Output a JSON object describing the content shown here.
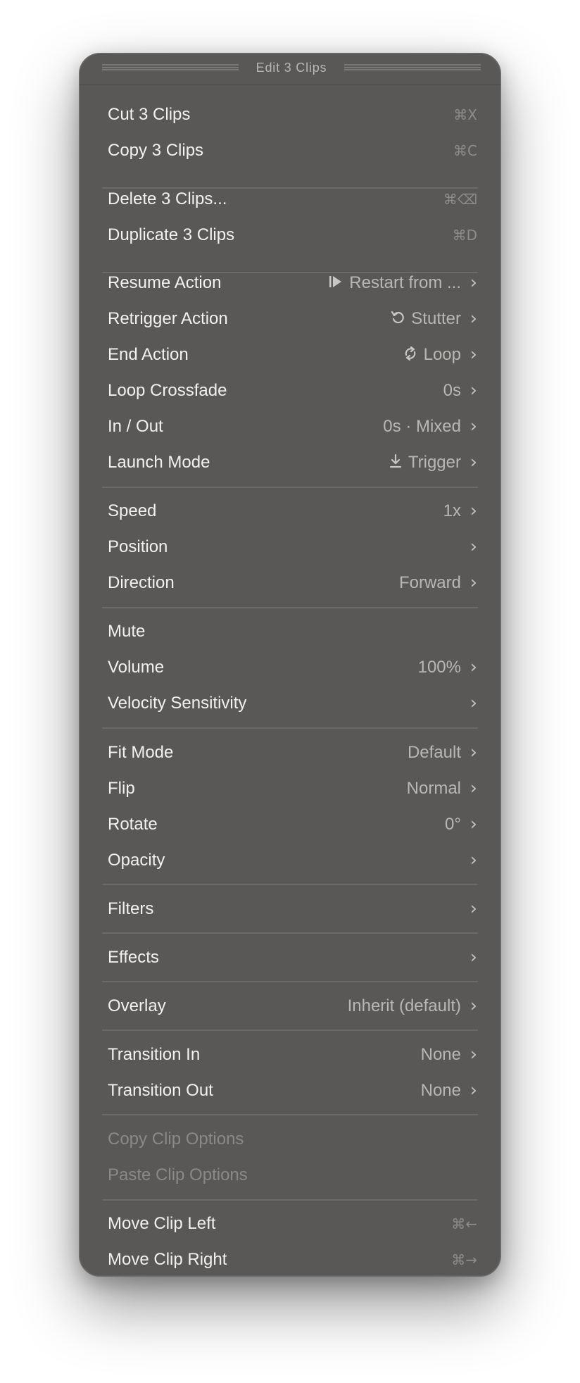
{
  "menu": {
    "title": "Edit 3 Clips",
    "items": [
      {
        "label": "Cut 3 Clips",
        "shortcut": "⌘X"
      },
      {
        "label": "Copy 3 Clips",
        "shortcut": "⌘C"
      },
      {
        "label": "Delete 3 Clips...",
        "shortcut": "⌘⌫"
      },
      {
        "label": "Duplicate 3 Clips",
        "shortcut": "⌘D"
      },
      {
        "label": "Resume Action",
        "value": "Restart from ...",
        "icon": "play-from-start-icon"
      },
      {
        "label": "Retrigger Action",
        "value": "Stutter",
        "icon": "rotate-back-icon"
      },
      {
        "label": "End Action",
        "value": "Loop",
        "icon": "loop-icon"
      },
      {
        "label": "Loop Crossfade",
        "value": "0s"
      },
      {
        "label": "In / Out",
        "value": "0s · Mixed"
      },
      {
        "label": "Launch Mode",
        "value": "Trigger",
        "icon": "download-icon"
      },
      {
        "label": "Speed",
        "value": "1x"
      },
      {
        "label": "Position",
        "value": ""
      },
      {
        "label": "Direction",
        "value": "Forward"
      },
      {
        "label": "Mute"
      },
      {
        "label": "Volume",
        "value": "100%"
      },
      {
        "label": "Velocity Sensitivity",
        "value": ""
      },
      {
        "label": "Fit Mode",
        "value": "Default"
      },
      {
        "label": "Flip",
        "value": "Normal"
      },
      {
        "label": "Rotate",
        "value": "0°"
      },
      {
        "label": "Opacity",
        "value": ""
      },
      {
        "label": "Filters",
        "value": ""
      },
      {
        "label": "Effects",
        "value": ""
      },
      {
        "label": "Overlay",
        "value": "Inherit (default)"
      },
      {
        "label": "Transition In",
        "value": "None"
      },
      {
        "label": "Transition Out",
        "value": "None"
      },
      {
        "label": "Copy Clip Options",
        "disabled": true
      },
      {
        "label": "Paste Clip Options",
        "disabled": true
      },
      {
        "label": "Move Clip Left",
        "shortcut": "⌘←"
      },
      {
        "label": "Move Clip Right",
        "shortcut": "⌘→"
      }
    ],
    "chevron": "›"
  },
  "colors": {
    "menu_background": "#595856",
    "text": "#f2f1ef",
    "value_text": "#b9b7b4",
    "disabled_text": "#8a8987",
    "separator": "#6b6a68"
  }
}
